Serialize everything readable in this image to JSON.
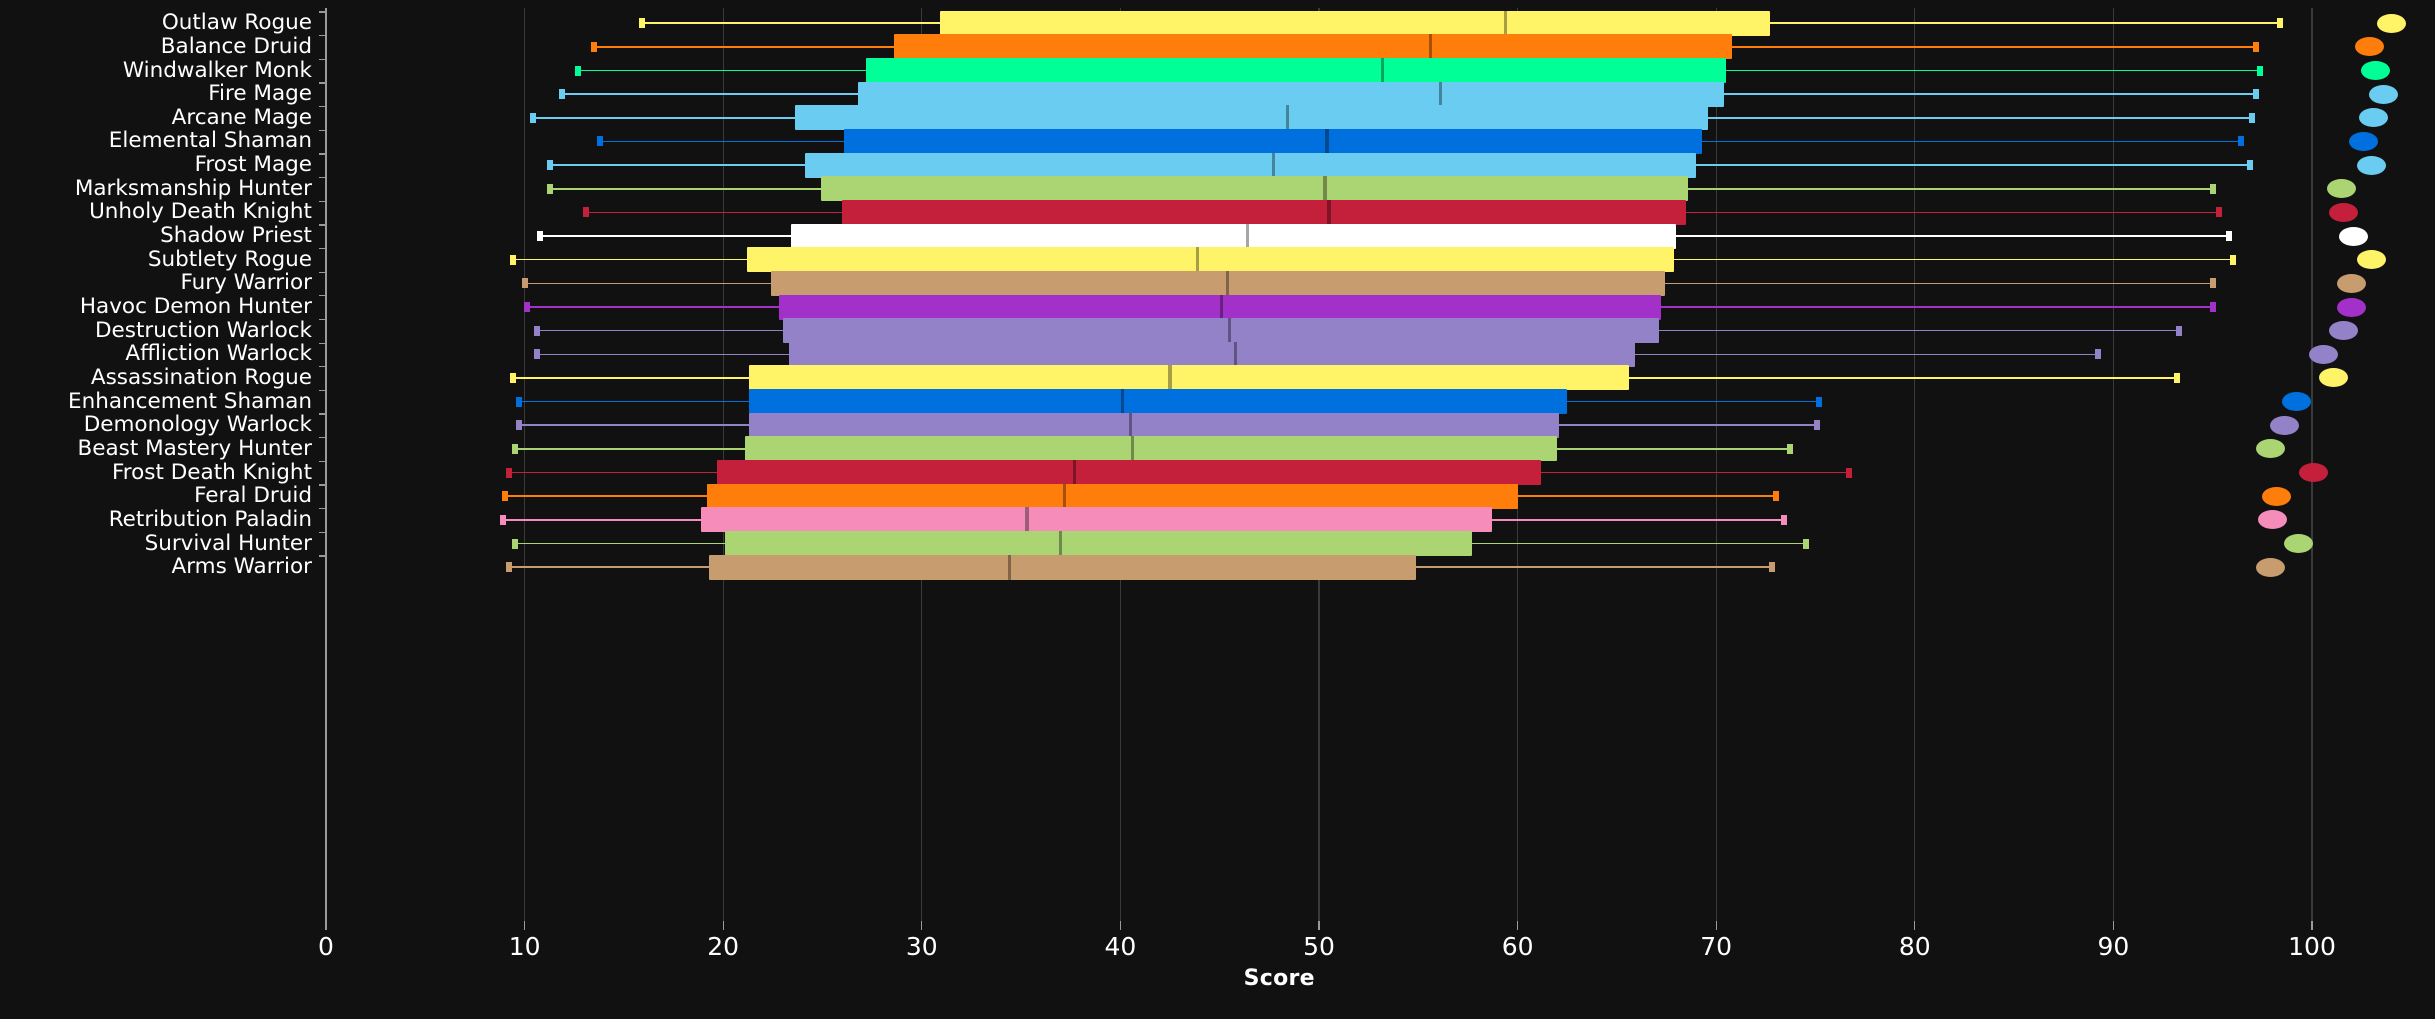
{
  "chart_data": {
    "type": "box",
    "title": "",
    "xlabel": "Score",
    "ylabel": "",
    "xlim": [
      0,
      104
    ],
    "xticks": [
      0,
      10,
      20,
      30,
      40,
      50,
      60,
      70,
      80,
      90,
      100
    ],
    "xticklabels": [
      "0",
      "10",
      "20",
      "30",
      "40",
      "50",
      "60",
      "70",
      "80",
      "90",
      "100"
    ],
    "grid": "vertical",
    "legend": "none",
    "background": "#111111",
    "text_color": "#ffffff",
    "grid_color": "#3a3a3a",
    "categories": [
      "Outlaw Rogue",
      "Balance Druid",
      "Windwalker Monk",
      "Fire Mage",
      "Arcane Mage",
      "Elemental Shaman",
      "Frost Mage",
      "Marksmanship Hunter",
      "Unholy Death Knight",
      "Shadow Priest",
      "Subtlety Rogue",
      "Fury Warrior",
      "Havoc Demon Hunter",
      "Destruction Warlock",
      "Affliction Warlock",
      "Assassination Rogue",
      "Enhancement Shaman",
      "Demonology Warlock",
      "Beast Mastery Hunter",
      "Frost Death Knight",
      "Feral Druid",
      "Retribution Paladin",
      "Survival Hunter",
      "Arms Warrior"
    ],
    "boxes": [
      {
        "label": "Outlaw Rogue",
        "color": "#fff468",
        "whisker_low": 15.9,
        "q1": 30.9,
        "median": 59.4,
        "q3": 72.7,
        "whisker_high": 98.4,
        "marker": 104.0
      },
      {
        "label": "Balance Druid",
        "color": "#ff7d0a",
        "whisker_low": 13.5,
        "q1": 28.6,
        "median": 55.6,
        "q3": 70.8,
        "whisker_high": 97.2,
        "marker": 102.9
      },
      {
        "label": "Windwalker Monk",
        "color": "#00ff96",
        "whisker_low": 12.7,
        "q1": 27.2,
        "median": 53.2,
        "q3": 70.5,
        "whisker_high": 97.4,
        "marker": 103.2
      },
      {
        "label": "Fire Mage",
        "color": "#69ccf0",
        "whisker_low": 11.9,
        "q1": 26.8,
        "median": 56.1,
        "q3": 70.4,
        "whisker_high": 97.2,
        "marker": 103.6
      },
      {
        "label": "Arcane Mage",
        "color": "#69ccf0",
        "whisker_low": 10.4,
        "q1": 23.6,
        "median": 48.4,
        "q3": 69.6,
        "whisker_high": 97.0,
        "marker": 103.1
      },
      {
        "label": "Elemental Shaman",
        "color": "#0070de",
        "whisker_low": 13.8,
        "q1": 26.1,
        "median": 50.4,
        "q3": 69.3,
        "whisker_high": 96.4,
        "marker": 102.6
      },
      {
        "label": "Frost Mage",
        "color": "#69ccf0",
        "whisker_low": 11.3,
        "q1": 24.1,
        "median": 47.7,
        "q3": 69.0,
        "whisker_high": 96.9,
        "marker": 103.0
      },
      {
        "label": "Marksmanship Hunter",
        "color": "#abd473",
        "whisker_low": 11.3,
        "q1": 24.9,
        "median": 50.3,
        "q3": 68.6,
        "whisker_high": 95.0,
        "marker": 101.5
      },
      {
        "label": "Unholy Death Knight",
        "color": "#c41f3b",
        "whisker_low": 13.1,
        "q1": 26.0,
        "median": 50.5,
        "q3": 68.5,
        "whisker_high": 95.3,
        "marker": 101.6
      },
      {
        "label": "Shadow Priest",
        "color": "#ffffff",
        "whisker_low": 10.8,
        "q1": 23.4,
        "median": 46.4,
        "q3": 68.0,
        "whisker_high": 95.8,
        "marker": 102.1
      },
      {
        "label": "Subtlety Rogue",
        "color": "#fff468",
        "whisker_low": 9.4,
        "q1": 21.2,
        "median": 43.9,
        "q3": 67.9,
        "whisker_high": 96.0,
        "marker": 103.0
      },
      {
        "label": "Fury Warrior",
        "color": "#c79c6e",
        "whisker_low": 10.0,
        "q1": 22.4,
        "median": 45.4,
        "q3": 67.4,
        "whisker_high": 95.0,
        "marker": 102.0
      },
      {
        "label": "Havoc Demon Hunter",
        "color": "#a330c9",
        "whisker_low": 10.1,
        "q1": 22.8,
        "median": 45.1,
        "q3": 67.2,
        "whisker_high": 95.0,
        "marker": 102.0
      },
      {
        "label": "Destruction Warlock",
        "color": "#9482c9",
        "whisker_low": 10.6,
        "q1": 23.0,
        "median": 45.5,
        "q3": 67.1,
        "whisker_high": 93.3,
        "marker": 101.6
      },
      {
        "label": "Affliction Warlock",
        "color": "#9482c9",
        "whisker_low": 10.6,
        "q1": 23.3,
        "median": 45.8,
        "q3": 65.9,
        "whisker_high": 89.2,
        "marker": 100.6
      },
      {
        "label": "Assassination Rogue",
        "color": "#fff468",
        "whisker_low": 9.4,
        "q1": 21.3,
        "median": 42.5,
        "q3": 65.6,
        "whisker_high": 93.2,
        "marker": 101.1
      },
      {
        "label": "Enhancement Shaman",
        "color": "#0070de",
        "whisker_low": 9.7,
        "q1": 21.3,
        "median": 40.1,
        "q3": 62.5,
        "whisker_high": 75.2,
        "marker": 99.2
      },
      {
        "label": "Demonology Warlock",
        "color": "#9482c9",
        "whisker_low": 9.7,
        "q1": 21.3,
        "median": 40.5,
        "q3": 62.1,
        "whisker_high": 75.1,
        "marker": 98.6
      },
      {
        "label": "Beast Mastery Hunter",
        "color": "#abd473",
        "whisker_low": 9.5,
        "q1": 21.1,
        "median": 40.6,
        "q3": 62.0,
        "whisker_high": 73.7,
        "marker": 97.9
      },
      {
        "label": "Frost Death Knight",
        "color": "#c41f3b",
        "whisker_low": 9.2,
        "q1": 19.7,
        "median": 37.7,
        "q3": 61.2,
        "whisker_high": 76.7,
        "marker": 100.1
      },
      {
        "label": "Feral Druid",
        "color": "#ff7d0a",
        "whisker_low": 9.0,
        "q1": 19.2,
        "median": 37.2,
        "q3": 60.0,
        "whisker_high": 73.0,
        "marker": 98.2
      },
      {
        "label": "Retribution Paladin",
        "color": "#f58cba",
        "whisker_low": 8.9,
        "q1": 18.9,
        "median": 35.3,
        "q3": 58.7,
        "whisker_high": 73.4,
        "marker": 98.0
      },
      {
        "label": "Survival Hunter",
        "color": "#abd473",
        "whisker_low": 9.5,
        "q1": 20.1,
        "median": 37.0,
        "q3": 57.7,
        "whisker_high": 74.5,
        "marker": 99.3
      },
      {
        "label": "Arms Warrior",
        "color": "#c79c6e",
        "whisker_low": 9.2,
        "q1": 19.3,
        "median": 34.4,
        "q3": 54.9,
        "whisker_high": 72.8,
        "marker": 97.9
      }
    ]
  },
  "axis": {
    "x_title": "Score"
  }
}
